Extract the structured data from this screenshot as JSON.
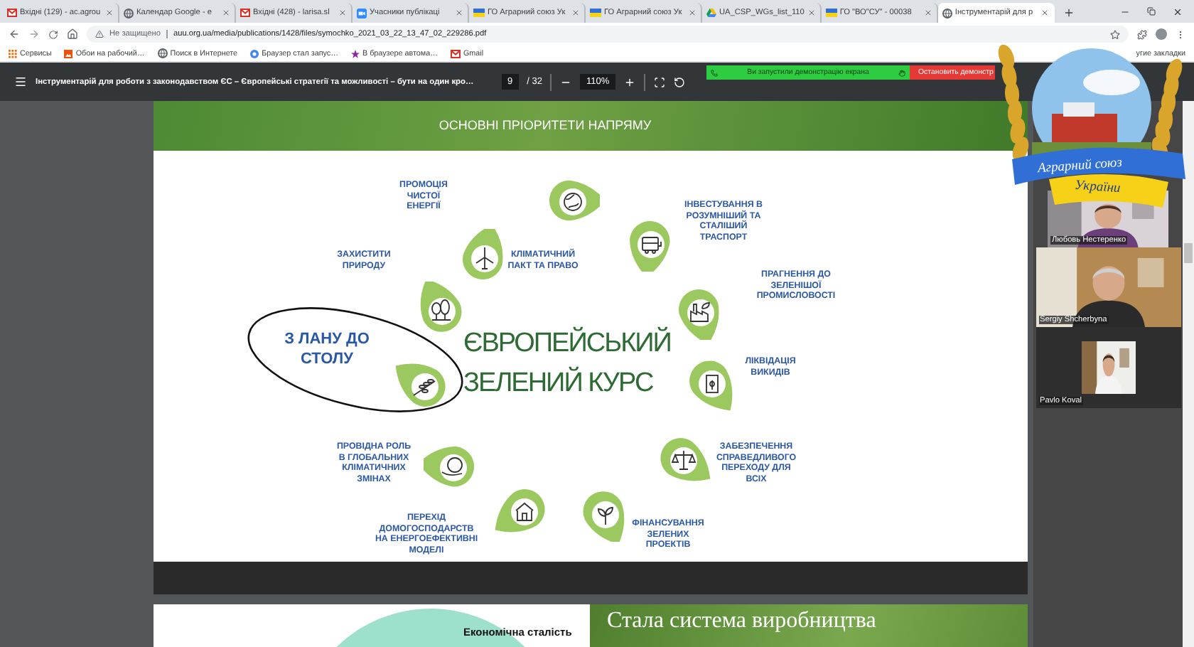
{
  "browser": {
    "tabs": [
      {
        "title": "Вхідні (129) - ac.agrou",
        "selected": false
      },
      {
        "title": "Календар Google - e",
        "selected": false
      },
      {
        "title": "Вхідні (428) - larisa.sl",
        "selected": false
      },
      {
        "title": "Учасники публікаці",
        "selected": false
      },
      {
        "title": "ГО Аграрний союз Ук",
        "selected": false
      },
      {
        "title": "ГО Аграрний союз Ук",
        "selected": false
      },
      {
        "title": "UA_CSP_WGs_list_110",
        "selected": false
      },
      {
        "title": "ГО \"ВО\"СУ\" - 00038",
        "selected": false
      },
      {
        "title": "Інструментарій для р",
        "selected": true
      }
    ],
    "address": {
      "security": "Не защищено",
      "url": "auu.org.ua/media/publications/1428/files/symochko_2021_03_22_13_47_02_229286.pdf"
    },
    "bookmarks": [
      {
        "label": "Сервисы"
      },
      {
        "label": "Обои на рабочий…"
      },
      {
        "label": "Поиск в Интернете"
      },
      {
        "label": "Браузер стал запус…"
      },
      {
        "label": "В браузере автома…"
      },
      {
        "label": "Gmail"
      }
    ],
    "other_bookmarks": "угие закладки"
  },
  "pdf_toolbar": {
    "title": "Інструментарій для роботи з законодавством ЄС – Європейські стратегії та можливості – бути на один кро…",
    "page": "9",
    "page_total": "/ 32",
    "zoom": "110%"
  },
  "share_bar": {
    "status": "Ви запустили демонстрацію екрана",
    "stop": "Остановить демонстр"
  },
  "logo": {
    "line_1": "Аграрний союз",
    "line_2": "України"
  },
  "slide": {
    "header": "ОСНОВНІ ПРІОРИТЕТИ НАПРЯМУ",
    "title": "ЄВРОПЕЙСЬКИЙ\nЗЕЛЕНИЙ КУРС",
    "priorities": [
      {
        "label": "ПРОМОЦІЯ\nЧИСТОЇ\nЕНЕРГІЇ",
        "kind": "wind-turbine",
        "circled": false
      },
      {
        "label": "ІНВЕСТУВАННЯ В\nРОЗУМНІШИЙ ТА\nСТАЛІШИЙ\nТРАСПОРТ",
        "kind": "bus",
        "circled": false
      },
      {
        "label": "ЗАХИСТИТИ\nПРИРОДУ",
        "kind": "trees",
        "circled": false
      },
      {
        "label": "КЛІМАТИЧНИЙ\nПАКТ ТА ПРАВО",
        "kind": "globe",
        "circled": false
      },
      {
        "label": "ПРАГНЕННЯ ДО\nЗЕЛЕНІШОЇ\nПРОМИСЛОВОСТІ",
        "kind": "factory",
        "circled": false
      },
      {
        "label": "З ЛАНУ ДО\nСТОЛУ",
        "kind": "wheat",
        "circled": true
      },
      {
        "label": "ЛІКВІДАЦІЯ\nВИКИДІВ",
        "kind": "battery",
        "circled": false
      },
      {
        "label": "ПРОВІДНА РОЛЬ\nВ ГЛОБАЛЬНИХ\nКЛІМАТИЧНИХ\nЗМІНАХ",
        "kind": "globe-in-hand",
        "circled": false
      },
      {
        "label": "ЗАБЕЗПЕЧЕННЯ\nСПРАВЕДЛИВОГО\nПЕРЕХОДУ ДЛЯ\nВСІХ",
        "kind": "scales",
        "circled": false
      },
      {
        "label": "ПЕРЕХІД\nДОМОГОСПОДАРСТВ\nНА ЕНЕРГОЕФЕКТИВНІ\nМОДЕЛІ",
        "kind": "house",
        "circled": false
      },
      {
        "label": "ФІНАНСУВАННЯ\nЗЕЛЕНИХ\nПРОЕКТІВ",
        "kind": "sprout",
        "circled": false
      }
    ]
  },
  "next_page": {
    "heading": "Економічна сталість",
    "banner": "Стала система виробництва"
  },
  "participants": [
    {
      "name": "Любовь Нестеренко"
    },
    {
      "name": "Sergiy Shcherbyna"
    },
    {
      "name": "Pavlo Koval"
    }
  ]
}
